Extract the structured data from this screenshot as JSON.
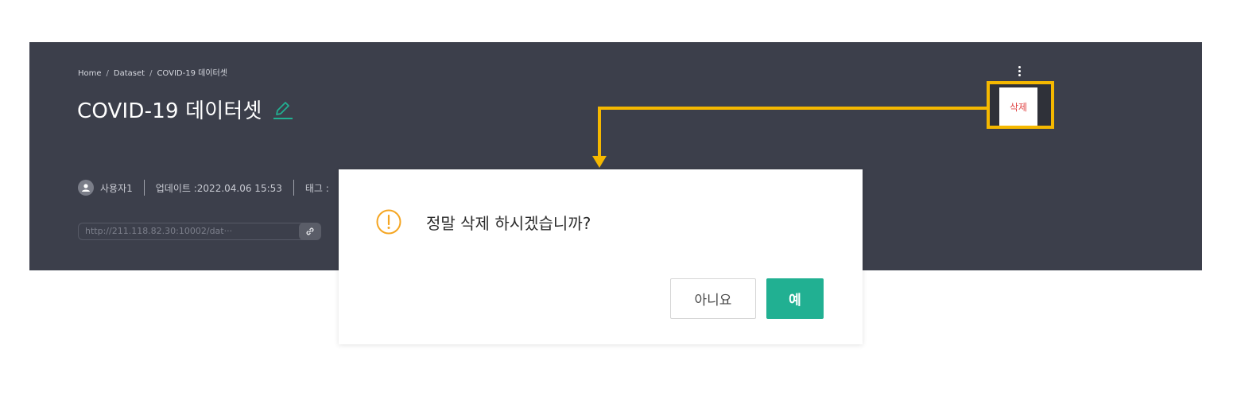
{
  "breadcrumb": [
    "Home",
    "Dataset",
    "COVID-19 데이터셋"
  ],
  "breadcrumb_separator": "/",
  "page_title": "COVID-19 데이터셋",
  "meta": {
    "user": "사용자1",
    "updated": "업데이트 :2022.04.06 15:53",
    "tags_label": "태그 :"
  },
  "url_value": "http://211.118.82.30:10002/dat···",
  "menu": {
    "delete_label": "삭제"
  },
  "dialog": {
    "message": "정말 삭제 하시겠습니까?",
    "no_label": "아니요",
    "yes_label": "예"
  },
  "icons": {
    "edit": "pencil-icon",
    "warning": "warning-circle-icon",
    "link": "link-icon",
    "more": "kebab-menu-icon",
    "user": "user-avatar-icon"
  },
  "colors": {
    "panel": "#3c3f4b",
    "highlight": "#f5b800",
    "accent": "#21b092",
    "danger": "#e04545",
    "warning": "#f5a623"
  }
}
